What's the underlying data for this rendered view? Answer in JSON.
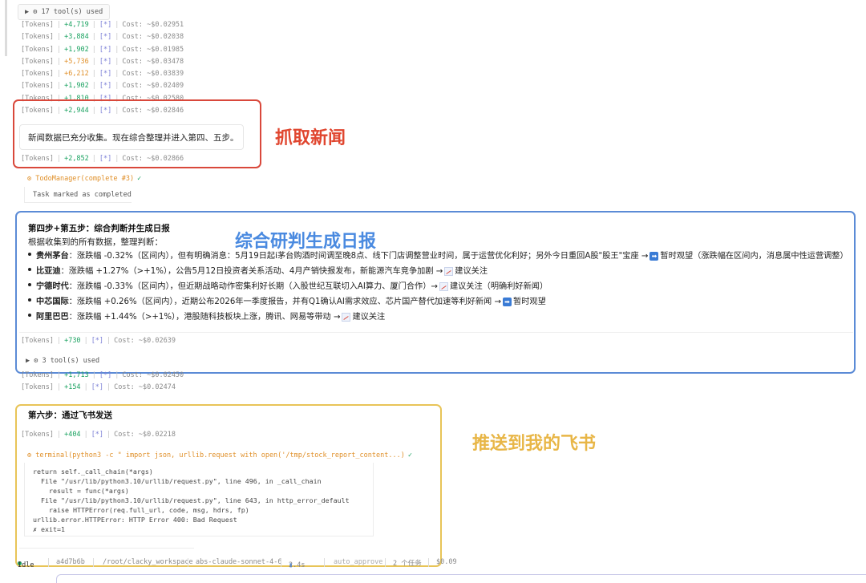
{
  "tools_chip": {
    "label": "17 tool(s) used",
    "icon": "play-gear-icon"
  },
  "token_rows_top": [
    {
      "label": "[Tokens]",
      "delta": "+4,719",
      "delta_color": "green",
      "star": "[*]",
      "cost": "Cost: ~$0.02951"
    },
    {
      "label": "[Tokens]",
      "delta": "+3,884",
      "delta_color": "green",
      "star": "[*]",
      "cost": "Cost: ~$0.02038"
    },
    {
      "label": "[Tokens]",
      "delta": "+1,902",
      "delta_color": "green",
      "star": "[*]",
      "cost": "Cost: ~$0.01985"
    },
    {
      "label": "[Tokens]",
      "delta": "+5,736",
      "delta_color": "orange",
      "star": "[*]",
      "cost": "Cost: ~$0.03478"
    },
    {
      "label": "[Tokens]",
      "delta": "+6,212",
      "delta_color": "orange",
      "star": "[*]",
      "cost": "Cost: ~$0.03839"
    },
    {
      "label": "[Tokens]",
      "delta": "+1,902",
      "delta_color": "green",
      "star": "[*]",
      "cost": "Cost: ~$0.02409"
    },
    {
      "label": "[Tokens]",
      "delta": "+1,810",
      "delta_color": "green",
      "star": "[*]",
      "cost": "Cost: ~$0.02580"
    },
    {
      "label": "[Tokens]",
      "delta": "+2,944",
      "delta_color": "green",
      "star": "[*]",
      "cost": "Cost: ~$0.02846"
    }
  ],
  "news_message": "新闻数据已充分收集。现在综合整理并进入第四、五步。",
  "token_row_after_news": {
    "label": "[Tokens]",
    "delta": "+2,852",
    "delta_color": "green",
    "star": "[*]",
    "cost": "Cost: ~$0.02866"
  },
  "todo": {
    "header": "TodoManager(complete #3)",
    "check": "✓",
    "result": "Task marked as completed"
  },
  "annotations": {
    "red": "抓取新闻",
    "blue": "综合研判生成日报",
    "yellow": "推送到我的飞书"
  },
  "analysis": {
    "title": "第四步+第五步：综合判断并生成日报",
    "intro": "根据收集到的所有数据，整理判断：",
    "items": [
      {
        "name": "贵州茅台",
        "text": "：涨跌幅 -0.32%（区间内），但有明确消息：5月19日起i茅台购酒时间调至晚8点、线下门店调整营业时间，属于运营优化利好；另外今日重回A股\"股王\"宝座 →",
        "icon": "arrow-right-icon",
        "advice": "暂时观望（涨跌幅在区间内，消息属中性运营调整）"
      },
      {
        "name": "比亚迪",
        "text": "：涨跌幅 +1.27%（>+1%），公告5月12日投资者关系活动、4月产销快报发布，新能源汽车竞争加剧 →",
        "icon": "chart-up-icon",
        "advice": "建议关注"
      },
      {
        "name": "宁德时代",
        "text": "：涨跌幅 -0.33%（区间内），但近期战略动作密集利好长期（入股世纪互联切入AI算力、厦门合作）→",
        "icon": "chart-up-icon",
        "advice": "建议关注（明确利好新闻）"
      },
      {
        "name": "中芯国际",
        "text": "：涨跌幅 +0.26%（区间内），近期公布2026年一季度报告，并有Q1确认AI需求效应、芯片国产替代加速等利好新闻 →",
        "icon": "arrow-right-icon",
        "advice": "暂时观望"
      },
      {
        "name": "阿里巴巴",
        "text": "：涨跌幅 +1.44%（>+1%），港股随科技板块上涨，腾讯、网易等带动 →",
        "icon": "chart-up-icon",
        "advice": "建议关注"
      }
    ]
  },
  "token_row_analysis": {
    "label": "[Tokens]",
    "delta": "+730",
    "delta_color": "green",
    "star": "[*]",
    "cost": "Cost: ~$0.02639"
  },
  "tools_chip_2": {
    "label": "3 tool(s) used",
    "icon": "play-gear-icon"
  },
  "token_rows_mid": [
    {
      "label": "[Tokens]",
      "delta": "+1,713",
      "delta_color": "green",
      "star": "[*]",
      "cost": "Cost: ~$0.02450"
    },
    {
      "label": "[Tokens]",
      "delta": "+154",
      "delta_color": "green",
      "star": "[*]",
      "cost": "Cost: ~$0.02474"
    }
  ],
  "step6": {
    "title": "第六步：通过飞书发送"
  },
  "token_row_step6": {
    "label": "[Tokens]",
    "delta": "+404",
    "delta_color": "green",
    "star": "[*]",
    "cost": "Cost: ~$0.02218"
  },
  "terminal": {
    "header": "terminal(python3 -c \" import json, urllib.request with open('/tmp/stock_report_content...)",
    "check": "✓",
    "lines": [
      "return self._call_chain(*args)",
      "  File \"/usr/lib/python3.10/urllib/request.py\", line 496, in _call_chain",
      "    result = func(*args)",
      "  File \"/usr/lib/python3.10/urllib/request.py\", line 643, in http_error_default",
      "    raise HTTPError(req.full_url, code, msg, hdrs, fp)",
      "urllib.error.HTTPError: HTTP Error 400: Bad Request",
      "✗ exit=1"
    ]
  },
  "statusbar": {
    "status": "Idle",
    "commit": "a4d7b6b",
    "path": "/root/clacky_workspace",
    "model": "abs-claude-sonnet-4-6",
    "time": "2.4s",
    "mode": "auto_approve",
    "tasks": "2 个任务",
    "cost": "$0.09"
  }
}
